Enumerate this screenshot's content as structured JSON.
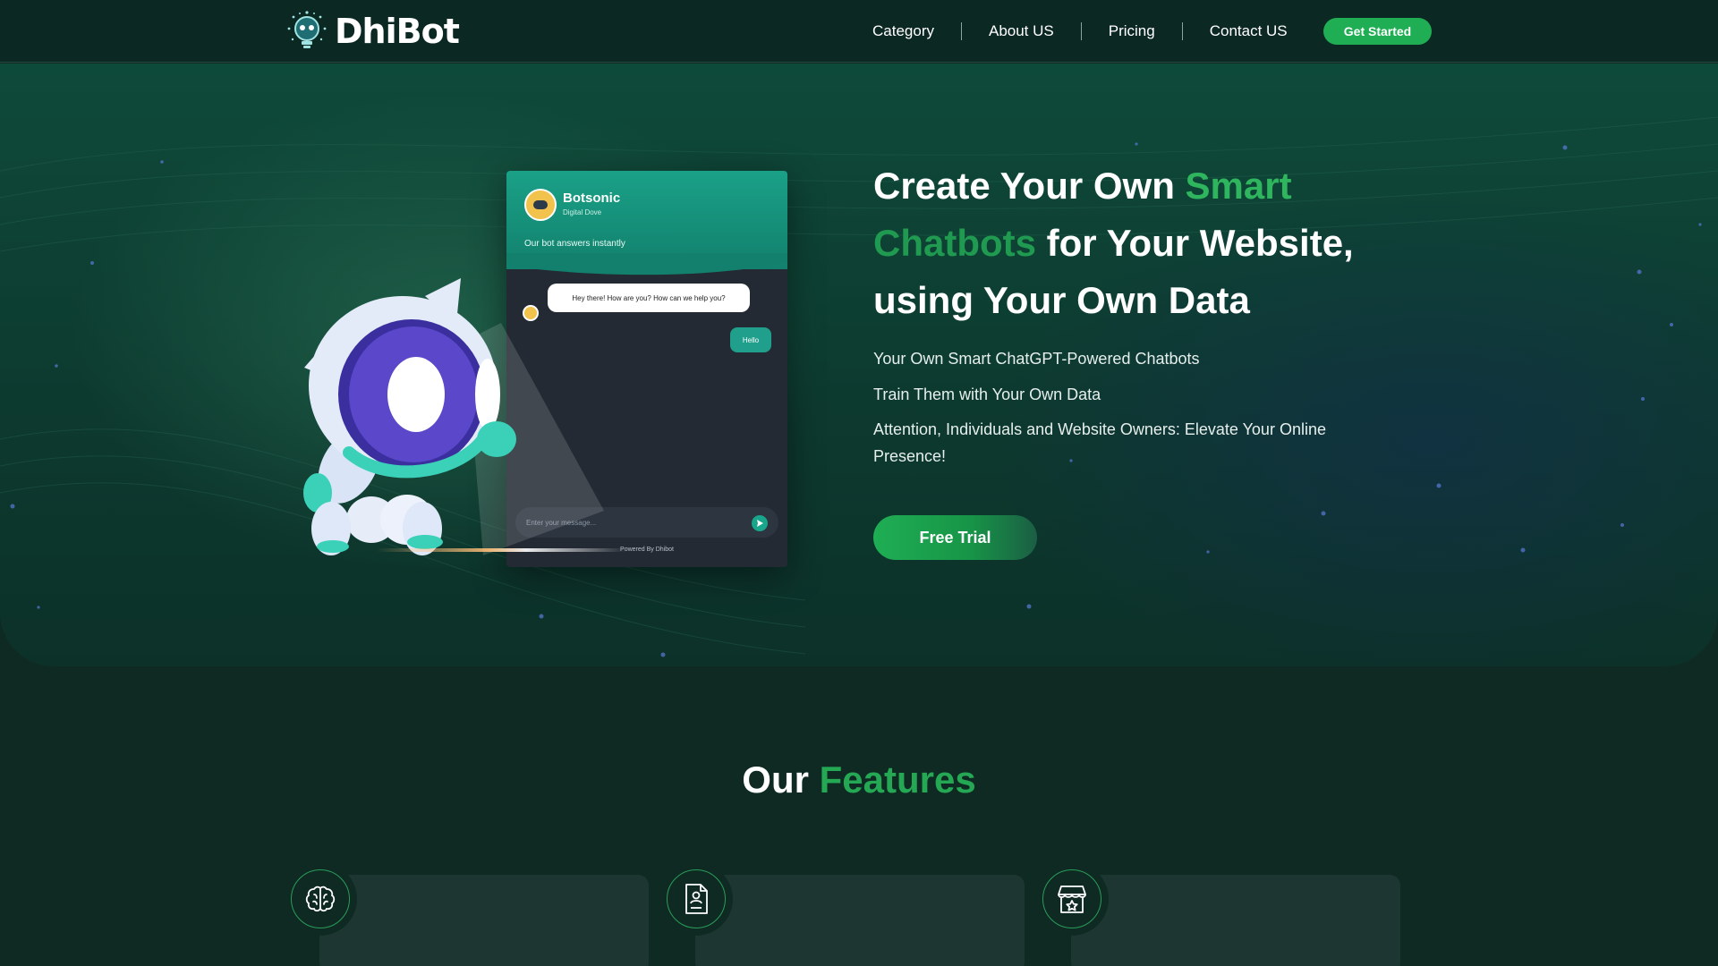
{
  "brand": {
    "name": "DhiBot",
    "logo_icon": "robot-bulb-icon"
  },
  "nav": {
    "links": [
      "Category",
      "About US",
      "Pricing",
      "Contact US"
    ],
    "cta_label": "Get Started"
  },
  "chat_widget": {
    "bot_name": "Botsonic",
    "bot_subtitle": "Digital Dove",
    "tagline": "Our bot answers instantly",
    "bot_message": "Hey there! How are you? How can we help you?",
    "user_message": "Hello",
    "input_placeholder": "Enter your message...",
    "powered_by": "Powered By Dhibot",
    "send_icon": "send-icon"
  },
  "hero": {
    "headline": {
      "part1": "Create Your Own ",
      "part2": "Smart",
      "part3": "Chatbots",
      "part4": " for Your Website, using Your Own Data"
    },
    "lines": [
      "Your Own Smart ChatGPT-Powered Chatbots",
      "Train Them with Your Own Data",
      "Attention, Individuals and Website Owners: Elevate Your Online Presence!"
    ],
    "cta_label": "Free Trial"
  },
  "features": {
    "title_part1": "Our ",
    "title_part2": "Features",
    "icons": [
      "brain-icon",
      "document-user-icon",
      "storefront-star-icon"
    ]
  },
  "colors": {
    "accent_green": "#1fae54",
    "nav_bg": "#0c2823",
    "page_bg": "#0f2a23",
    "chat_teal": "#1aa187"
  }
}
